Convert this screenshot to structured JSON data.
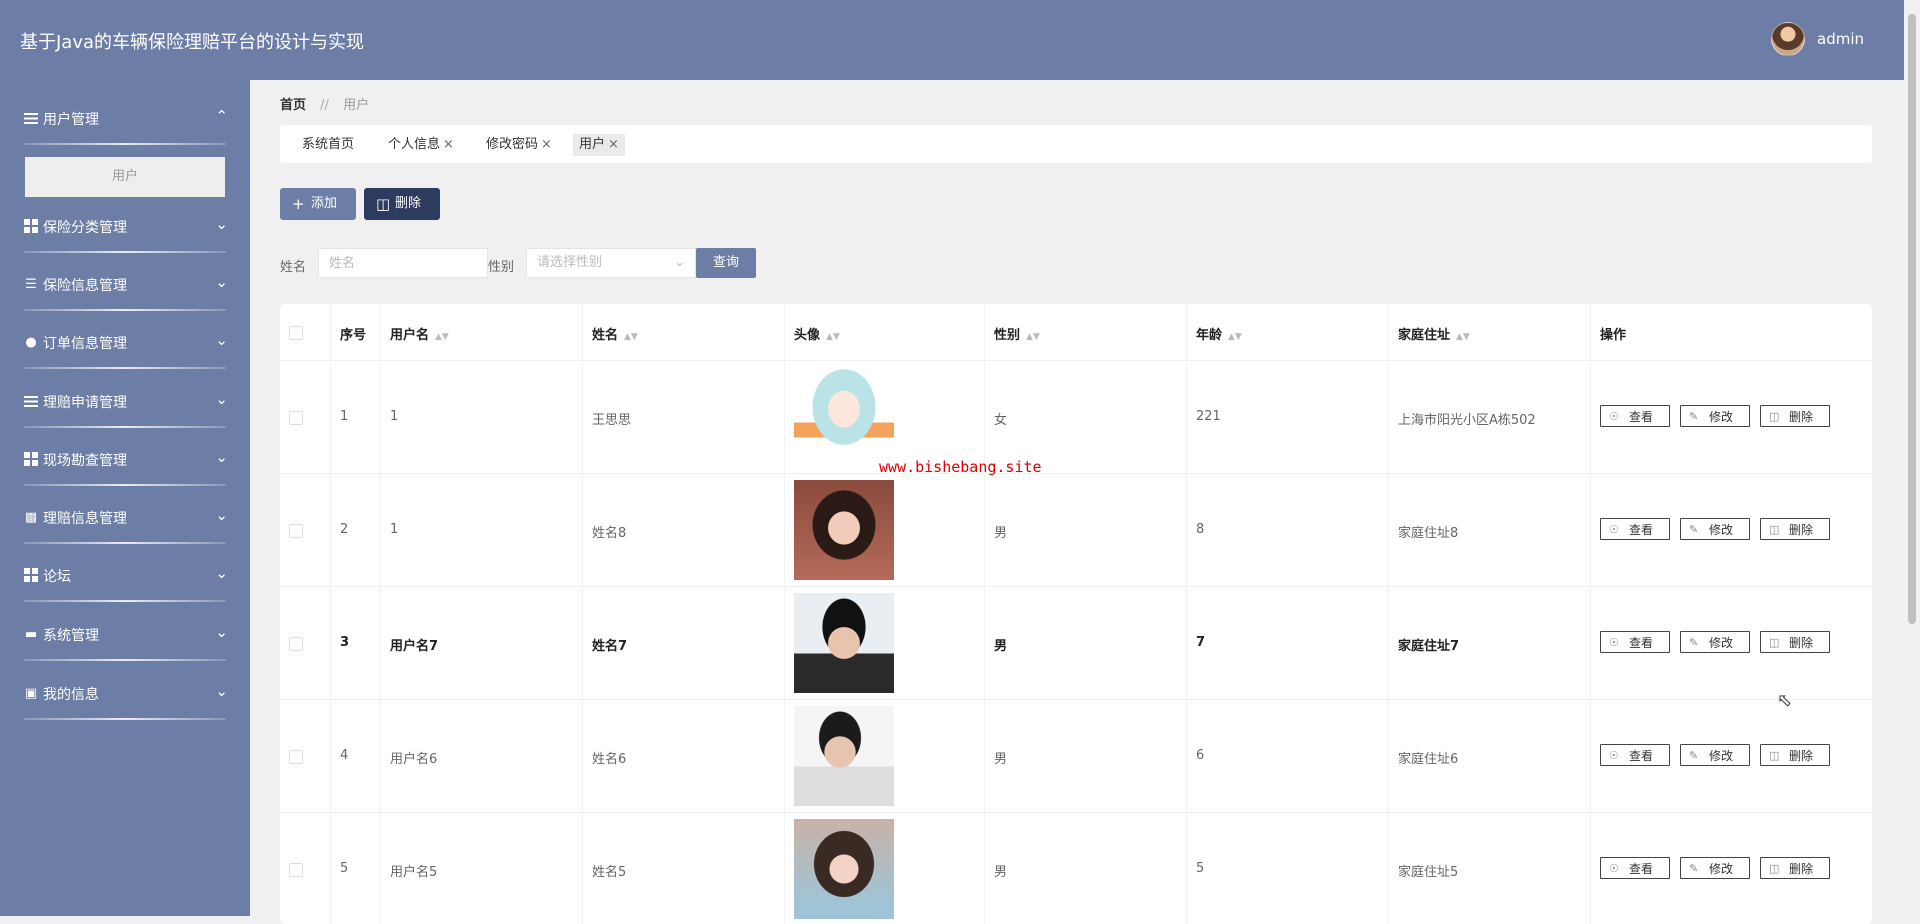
{
  "app": {
    "title": "基于Java的车辆保险理赔平台的设计与实现",
    "user": "admin"
  },
  "sidebar": {
    "groups": [
      {
        "label": "用户管理",
        "icon": "list-icon",
        "expanded": true,
        "sub": [
          "用户"
        ]
      },
      {
        "label": "保险分类管理",
        "icon": "grid-icon"
      },
      {
        "label": "保险信息管理",
        "icon": "sliders-icon"
      },
      {
        "label": "订单信息管理",
        "icon": "person-icon"
      },
      {
        "label": "理赔申请管理",
        "icon": "list-icon"
      },
      {
        "label": "现场勘查管理",
        "icon": "grid-icon"
      },
      {
        "label": "理赔信息管理",
        "icon": "clipboard-icon"
      },
      {
        "label": "论坛",
        "icon": "grid-icon"
      },
      {
        "label": "系统管理",
        "icon": "monitor-icon"
      },
      {
        "label": "我的信息",
        "icon": "card-icon"
      }
    ]
  },
  "breadcrumb": {
    "home": "首页",
    "sep": "//",
    "current": "用户"
  },
  "tabs": [
    {
      "label": "系统首页",
      "closable": false
    },
    {
      "label": "个人信息",
      "closable": true
    },
    {
      "label": "修改密码",
      "closable": true
    },
    {
      "label": "用户",
      "closable": true,
      "active": true
    }
  ],
  "toolbar": {
    "add": "添加",
    "delete": "删除"
  },
  "search": {
    "name_label": "姓名",
    "name_placeholder": "姓名",
    "gender_label": "性别",
    "gender_placeholder": "请选择性别",
    "query": "查询"
  },
  "table": {
    "columns": [
      "序号",
      "用户名",
      "姓名",
      "头像",
      "性别",
      "年龄",
      "家庭住址",
      "操作"
    ],
    "rows": [
      {
        "idx": "1",
        "username": "1",
        "name": "王思思",
        "gender": "女",
        "age": "221",
        "address": "上海市阳光小区A栋502"
      },
      {
        "idx": "2",
        "username": "1",
        "name": "姓名8",
        "gender": "男",
        "age": "8",
        "address": "家庭住址8"
      },
      {
        "idx": "3",
        "username": "用户名7",
        "name": "姓名7",
        "gender": "男",
        "age": "7",
        "address": "家庭住址7"
      },
      {
        "idx": "4",
        "username": "用户名6",
        "name": "姓名6",
        "gender": "男",
        "age": "6",
        "address": "家庭住址6"
      },
      {
        "idx": "5",
        "username": "用户名5",
        "name": "姓名5",
        "gender": "男",
        "age": "5",
        "address": "家庭住址5"
      }
    ],
    "actions": {
      "view": "查看",
      "edit": "修改",
      "delete": "删除"
    }
  },
  "watermark": "www.bishebang.site",
  "colors": {
    "primary": "#6c7ea6",
    "dark_button": "#2c3b5e"
  }
}
